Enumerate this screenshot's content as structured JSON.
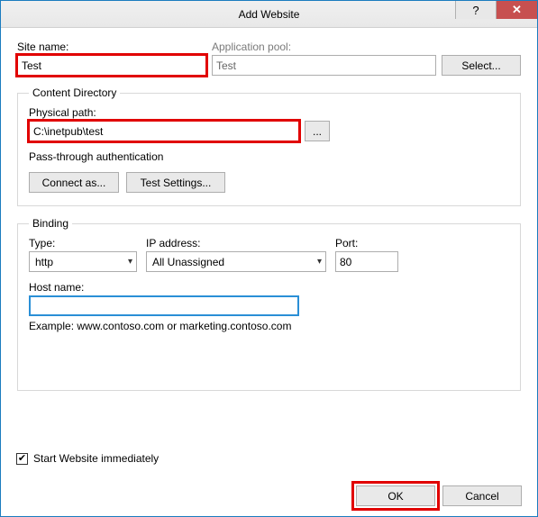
{
  "window": {
    "title": "Add Website",
    "help_glyph": "?",
    "close_glyph": "✕"
  },
  "site_name": {
    "label": "Site name:",
    "value": "Test"
  },
  "app_pool": {
    "label": "Application pool:",
    "value": "Test",
    "select_btn": "Select..."
  },
  "content_dir": {
    "legend": "Content Directory",
    "path_label": "Physical path:",
    "path_value": "C:\\inetpub\\test",
    "browse_btn": "...",
    "pass_label": "Pass-through authentication",
    "connect_btn": "Connect as...",
    "test_btn": "Test Settings..."
  },
  "binding": {
    "legend": "Binding",
    "type_label": "Type:",
    "type_value": "http",
    "ip_label": "IP address:",
    "ip_value": "All Unassigned",
    "port_label": "Port:",
    "port_value": "80",
    "host_label": "Host name:",
    "host_value": "",
    "example": "Example: www.contoso.com or marketing.contoso.com"
  },
  "start_immediate": {
    "label": "Start Website immediately",
    "check": "✔"
  },
  "buttons": {
    "ok": "OK",
    "cancel": "Cancel"
  }
}
